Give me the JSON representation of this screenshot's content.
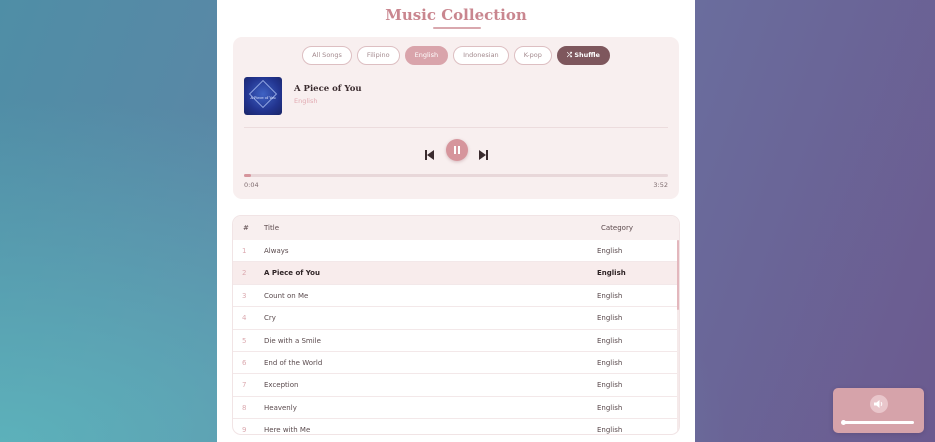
{
  "app": {
    "title": "Music Collection"
  },
  "filters": [
    {
      "label": "All Songs",
      "active": false
    },
    {
      "label": "Filipino",
      "active": false
    },
    {
      "label": "English",
      "active": true
    },
    {
      "label": "Indonesian",
      "active": false
    },
    {
      "label": "K-pop",
      "active": false
    }
  ],
  "shuffle_label": "Shuffle",
  "now_playing": {
    "title": "A Piece of You",
    "category": "English",
    "art_text": "A Piece of You",
    "current_time": "0:04",
    "total_time": "3:52",
    "progress": 0.017,
    "is_playing": true
  },
  "table": {
    "headers": {
      "num": "#",
      "title": "Title",
      "category": "Category"
    },
    "rows": [
      {
        "num": "1",
        "title": "Always",
        "category": "English",
        "active": false
      },
      {
        "num": "2",
        "title": "A Piece of You",
        "category": "English",
        "active": true
      },
      {
        "num": "3",
        "title": "Count on Me",
        "category": "English",
        "active": false
      },
      {
        "num": "4",
        "title": "Cry",
        "category": "English",
        "active": false
      },
      {
        "num": "5",
        "title": "Die with a Smile",
        "category": "English",
        "active": false
      },
      {
        "num": "6",
        "title": "End of the World",
        "category": "English",
        "active": false
      },
      {
        "num": "7",
        "title": "Exception",
        "category": "English",
        "active": false
      },
      {
        "num": "8",
        "title": "Heavenly",
        "category": "English",
        "active": false
      },
      {
        "num": "9",
        "title": "Here with Me",
        "category": "English",
        "active": false
      }
    ]
  },
  "volume": {
    "level": 0.97
  },
  "icons": {
    "prev": "skip-previous-icon",
    "play": "pause-icon",
    "next": "skip-next-icon",
    "shuffle": "shuffle-icon",
    "volume": "volume-icon"
  },
  "colors": {
    "accent": "#d6959c",
    "accent_dark": "#7e575d",
    "title": "#c9868f",
    "panel": "#f8efef"
  }
}
